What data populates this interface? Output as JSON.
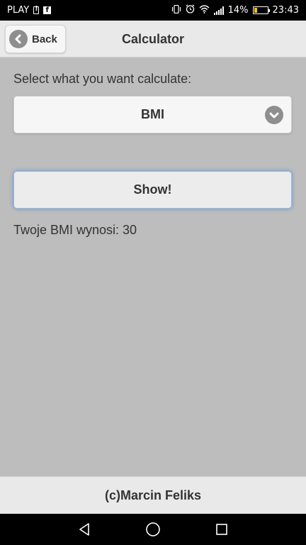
{
  "status_bar": {
    "carrier": "PLAY",
    "battery_percent": "14%",
    "time": "23:43",
    "battery_level": 0.14,
    "battery_color": "#f5c400",
    "icons": [
      "sim-alert-icon",
      "facebook-icon",
      "vibrate-icon",
      "alarm-icon",
      "wifi-icon",
      "signal-icon",
      "battery-icon"
    ]
  },
  "header": {
    "back_label": "Back",
    "title": "Calculator",
    "back_icon": "chevron-left-icon"
  },
  "form": {
    "select_label": "Select what you want calculate:",
    "select_value": "BMI",
    "select_icon": "chevron-down-icon",
    "show_button_label": "Show!",
    "result_text": "Twoje BMI wynosi: 30"
  },
  "footer": {
    "text": "(c)Marcin Feliks"
  },
  "nav_bar": {
    "icons": [
      "back-triangle-icon",
      "home-circle-icon",
      "recents-square-icon"
    ]
  },
  "colors": {
    "background": "#bdbdbd",
    "bar": "#e9e9e9",
    "focus_glow": "#3882d2"
  }
}
